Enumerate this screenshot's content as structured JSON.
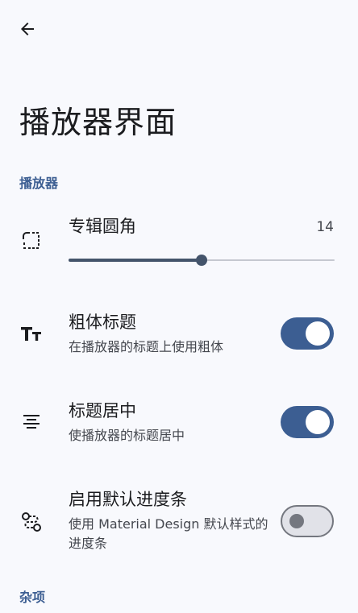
{
  "app": {
    "title": "播放器界面"
  },
  "sections": {
    "player": "播放器",
    "misc": "杂项"
  },
  "settings": {
    "album_corner": {
      "title": "专辑圆角",
      "value": "14",
      "slider_fraction": 0.5,
      "icon": "rounded-corner-icon"
    },
    "bold_title": {
      "title": "粗体标题",
      "subtitle": "在播放器的标题上使用粗体",
      "enabled": true,
      "icon": "text-fields-icon"
    },
    "center_title": {
      "title": "标题居中",
      "subtitle": "使播放器的标题居中",
      "enabled": true,
      "icon": "align-center-icon"
    },
    "default_progress": {
      "title": "启用默认进度条",
      "subtitle": "使用 Material Design 默认样式的进度条",
      "enabled": false,
      "icon": "route-icon"
    }
  },
  "colors": {
    "accent": "#3c5e92",
    "background": "#f8f9fd"
  }
}
